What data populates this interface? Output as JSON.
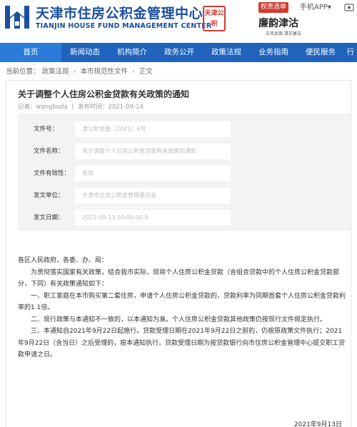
{
  "header": {
    "logo_cn": "天津市住房公积金管理中心",
    "logo_en": "TIANJIN HOUSE FUND MANAGEMENT CENTER",
    "seal_text": "天津公积",
    "badge": "权责清单",
    "mobile_app": "手机APP",
    "mobile_arrow": "▾",
    "slogan": "廉韵津沽",
    "slogan_sub": "正风反腐 清正廉洁",
    "accent_color": "#1f63bd"
  },
  "nav": {
    "items": [
      "首页",
      "新闻动态",
      "机构简介",
      "政务公开",
      "政策法规",
      "业务指南",
      "便民服务",
      "行"
    ]
  },
  "breadcrumb": {
    "label": "当前位置：",
    "items": [
      "政策法规",
      "本市规范性文件",
      "正文"
    ],
    "sep": "›"
  },
  "article": {
    "title": "关于调整个人住房公积金贷款有关政策的通知",
    "author": "记者：wangboda",
    "sep": "|",
    "publish_time": "发布时间：2021-09-14",
    "info": [
      {
        "label": "文件号：",
        "value": "津公积金委〔2021〕6号"
      },
      {
        "label": "文件名称：",
        "value": "关于调整个人住房公积金贷款有关政策的通知"
      },
      {
        "label": "文件有效性：",
        "value": "有效"
      },
      {
        "label": "发文单位：",
        "value": "天津市住房公积金管理委员会"
      },
      {
        "label": "发文日期：",
        "value": "2021-09-13 00:00:00.0"
      }
    ],
    "body": {
      "greeting": "各区人民政府，各委、办、局：",
      "p1": "为贯彻落实国家有关政策，结合我市实际，现将个人住房公积金贷款（含组合贷款中的个人住房公积金贷款部分，下同）有关政策通知如下：",
      "p2": "一、职工家庭在本市购买第二套住房，申请个人住房公积金贷款的，贷款利率为同期首套个人住房公积金贷款利率的1.1倍。",
      "p3": "二、现行政策与本通知不一致的，以本通知为准。个人住房公积金贷款其他政策仍按现行文件规定执行。",
      "p4": "三、本通知自2021年9月22日起施行。贷款受理日期在2021年9月22日之前的，仍按原政策文件执行；2021年9月22日（含当日）之后受理的，按本通知执行。贷款受理日期为按贷款银行向市住房公积金管理中心提交职工贷款申请之日。"
    },
    "date": "2021年9月13日"
  }
}
